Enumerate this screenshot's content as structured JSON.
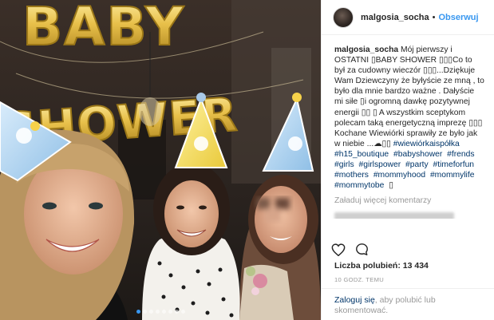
{
  "photo": {
    "balloons_top": "BABY",
    "balloons_bottom": "SHOWER",
    "carousel_dot_count": 8,
    "carousel_active_index": 0
  },
  "header": {
    "username": "malgosia_socha",
    "separator": "•",
    "follow_label": "Obserwuj"
  },
  "caption": {
    "username": "malgosia_socha",
    "text": " Mój pierwszy i OSTATNI ▯BABY SHOWER ▯▯▯Co to był za cudowny wieczór ▯▯▯...Dziękuje Wam Dziewczyny że byłyście ze mną , to było dla mnie bardzo ważne . Dałyście mi siłe ▯i ogromną dawkę pozytywnej energii ▯▯ ▯ A wszystkim sceptykom polecam taką energetyczną imprezę ▯▯▯ Kochane Wiewiórki sprawiły ze było jak w niebie ...☁▯▯",
    "hashtags": [
      "#wiewiórkaispółka",
      "#h15_boutique",
      "#babyshower",
      "#frends",
      "#girls",
      "#girlspower",
      "#party",
      "#timeforfun",
      "#mothers",
      "#mommyhood",
      "#mommylife",
      "#mommytobe"
    ],
    "tail": "▯"
  },
  "comments": {
    "load_more_label": "Załaduj więcej komentarzy"
  },
  "likes": {
    "label": "Liczba polubień:",
    "count": "13 434"
  },
  "time_ago": "10 GODZ. TEMU",
  "login": {
    "link_label": "Zaloguj się",
    "rest": ", aby polubić lub skomentować."
  },
  "colors": {
    "link_blue": "#3897f0",
    "hashtag_navy": "#003569",
    "muted_gray": "#999999",
    "balloon_gold": "#e8c04a"
  },
  "icons": {
    "like": "heart-icon",
    "comment": "comment-icon"
  }
}
